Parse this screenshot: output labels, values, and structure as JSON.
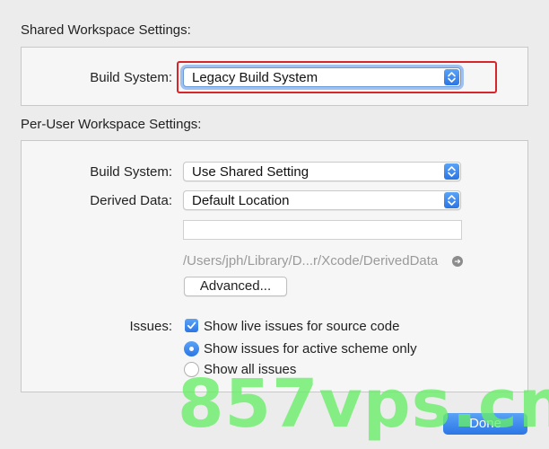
{
  "shared": {
    "title": "Shared Workspace Settings:",
    "build_system_label": "Build System:",
    "build_system_value": "Legacy Build System"
  },
  "per_user": {
    "title": "Per-User Workspace Settings:",
    "build_system_label": "Build System:",
    "build_system_value": "Use Shared Setting",
    "derived_data_label": "Derived Data:",
    "derived_data_value": "Default Location",
    "custom_path_value": "",
    "path_display": "/Users/jph/Library/D...r/Xcode/DerivedData",
    "advanced_label": "Advanced...",
    "issues_label": "Issues:",
    "live_issues_label": "Show live issues for source code",
    "live_issues_checked": true,
    "active_scheme_label": "Show issues for active scheme only",
    "all_issues_label": "Show all issues",
    "selected_issue_scope": "active_scheme"
  },
  "footer": {
    "done_label": "Done"
  },
  "watermark": "857vps.cn",
  "colors": {
    "accent": "#2b75e6",
    "highlight_box": "#d7262b",
    "watermark": "#66ee66"
  }
}
